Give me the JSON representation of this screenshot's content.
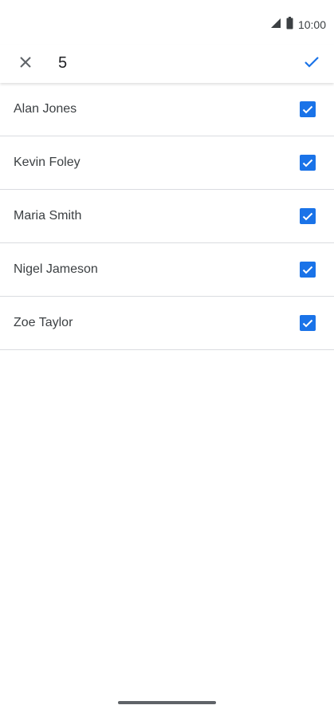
{
  "status_bar": {
    "time": "10:00",
    "icons": [
      "signal-icon",
      "battery-icon"
    ]
  },
  "toolbar": {
    "close_icon": "close-icon",
    "selected_count": "5",
    "confirm_icon": "check-icon"
  },
  "contacts": [
    {
      "name": "Alan Jones",
      "checked": true
    },
    {
      "name": "Kevin Foley",
      "checked": true
    },
    {
      "name": "Maria Smith",
      "checked": true
    },
    {
      "name": "Nigel Jameson",
      "checked": true
    },
    {
      "name": "Zoe Taylor",
      "checked": true
    }
  ],
  "colors": {
    "accent": "#1a73e8",
    "divider": "#dadce0",
    "text": "#3c4043"
  }
}
